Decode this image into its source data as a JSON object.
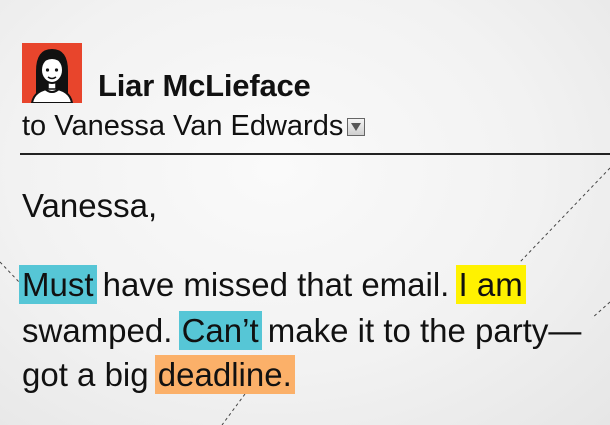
{
  "email": {
    "sender": {
      "name": "Liar McLieface",
      "avatar_icon": "woman-avatar-icon",
      "avatar_bg": "#e8452c"
    },
    "recipient": {
      "prefix": "to",
      "name": "Vanessa Van Edwards",
      "dropdown_icon": "chevron-down-icon"
    },
    "greeting": "Vanessa,",
    "body": {
      "line1": {
        "hl1": "Must",
        "text1": " have missed that email. ",
        "hl2": "I am"
      },
      "line2": {
        "text1": "swamped. ",
        "hl1": "Can’t",
        "text2": " make it to the party—"
      },
      "line3": {
        "text1": "got a big ",
        "hl1": "deadline."
      }
    }
  },
  "colors": {
    "highlight_blue": "#56c6d6",
    "highlight_yellow": "#fff200",
    "highlight_orange": "#fbb069"
  }
}
